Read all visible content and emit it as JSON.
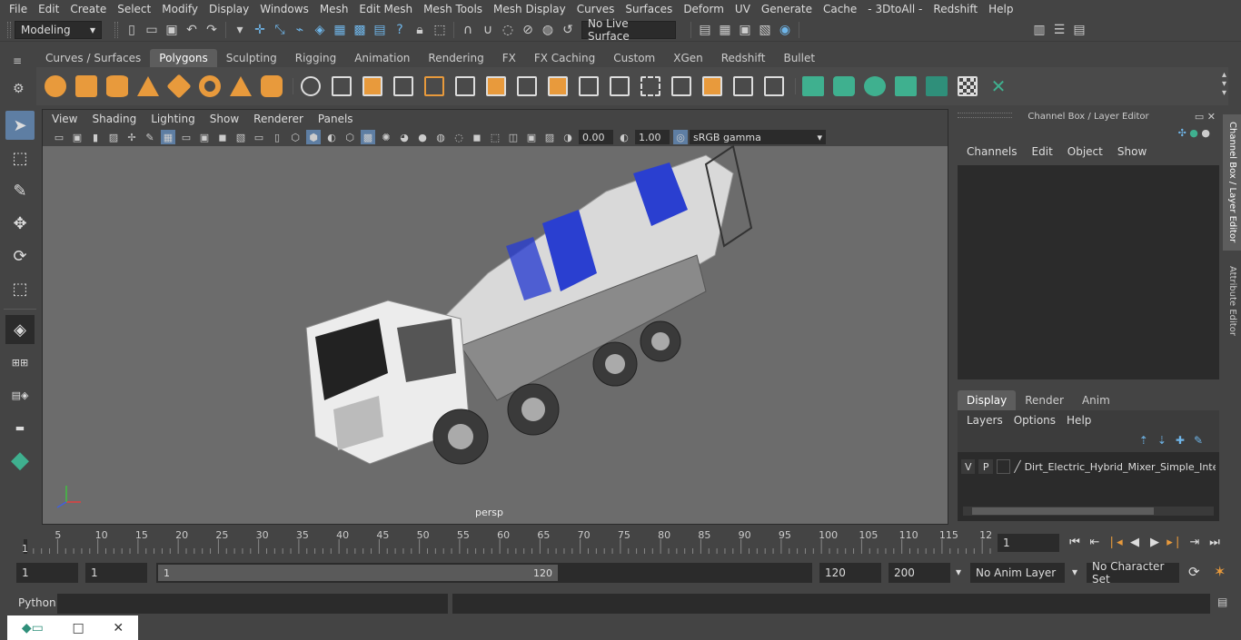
{
  "menu": [
    "File",
    "Edit",
    "Create",
    "Select",
    "Modify",
    "Display",
    "Windows",
    "Mesh",
    "Edit Mesh",
    "Mesh Tools",
    "Mesh Display",
    "Curves",
    "Surfaces",
    "Deform",
    "UV",
    "Generate",
    "Cache",
    "- 3DtoAll -",
    "Redshift",
    "Help"
  ],
  "status": {
    "mode": "Modeling",
    "live_surface": "No Live Surface"
  },
  "shelf_tabs": [
    "Curves / Surfaces",
    "Polygons",
    "Sculpting",
    "Rigging",
    "Animation",
    "Rendering",
    "FX",
    "FX Caching",
    "Custom",
    "XGen",
    "Redshift",
    "Bullet"
  ],
  "active_shelf_tab": "Polygons",
  "viewport": {
    "menu": [
      "View",
      "Shading",
      "Lighting",
      "Show",
      "Renderer",
      "Panels"
    ],
    "exposure": "0.00",
    "gamma": "1.00",
    "color_space": "sRGB gamma",
    "camera_label": "persp"
  },
  "channel_box": {
    "title": "Channel Box / Layer Editor",
    "menu": [
      "Channels",
      "Edit",
      "Object",
      "Show"
    ],
    "layer_tabs": [
      "Display",
      "Render",
      "Anim"
    ],
    "active_layer_tab": "Display",
    "layer_menu": [
      "Layers",
      "Options",
      "Help"
    ],
    "layer": {
      "v": "V",
      "p": "P",
      "name": "Dirt_Electric_Hybrid_Mixer_Simple_Inter"
    }
  },
  "side_tabs": [
    "Channel Box / Layer Editor",
    "Attribute Editor"
  ],
  "timeline": {
    "ticks": [
      "5",
      "10",
      "15",
      "20",
      "25",
      "30",
      "35",
      "40",
      "45",
      "50",
      "55",
      "60",
      "65",
      "70",
      "75",
      "80",
      "85",
      "90",
      "95",
      "100",
      "105",
      "110",
      "115",
      "12"
    ],
    "start_label": "1",
    "current_frame": "1"
  },
  "range": {
    "start": "1",
    "start2": "1",
    "range_start": "1",
    "range_end": "120",
    "end": "120",
    "end2": "200",
    "anim_layer": "No Anim Layer",
    "char_set": "No Character Set"
  },
  "cmd": {
    "label": "Python"
  }
}
